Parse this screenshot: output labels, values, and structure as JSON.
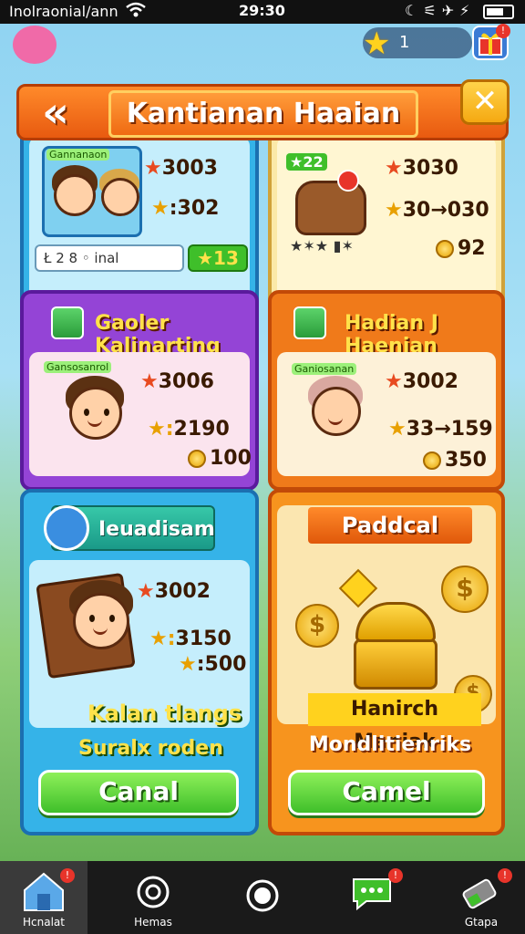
{
  "status_bar": {
    "carrier": "Inolraonial/ann",
    "time": "29:30"
  },
  "top_hud": {
    "star_count": "1"
  },
  "panel": {
    "title": "Kantianan Haaian",
    "back_glyph": "«",
    "close_glyph": "✕"
  },
  "card_top_left": {
    "tag": "Gannanaon",
    "stat_1": "3003",
    "stat_2": ":302",
    "progress_label": "Ł 2 8 ◦ inal",
    "progress": 0.6,
    "reward": "13"
  },
  "card_top_right": {
    "tag": "22",
    "stat_1": "3030",
    "stat_2": "30→030",
    "stars_text": "★✶★ ▮✶",
    "reward": "92"
  },
  "card_mid_left": {
    "header": "Gaoler Kalinarting",
    "tag": "Gansosanrol",
    "stat_1": "3006",
    "stat_2": "2190",
    "coins": "100"
  },
  "card_mid_right": {
    "header": "Hadian J Haenian",
    "tag": "Ganiosanan",
    "stat_1": "3002",
    "stat_2": "33→159",
    "coins": "350"
  },
  "card_bottom_left": {
    "header": "Ieuadisam",
    "stat_1": "3002",
    "stat_2": "3150",
    "stat_3": ":500",
    "line_1": "Kalan tlangs",
    "line_2": "Suralx roden",
    "button": "Canal"
  },
  "card_bottom_right": {
    "header": "Paddcal",
    "line_1": "Hanirch Maniak",
    "line_2": "Mondlitienriks",
    "button": "Camel"
  },
  "bottom_nav": {
    "items": [
      {
        "label": "Hcnalat",
        "badge": "!"
      },
      {
        "label": "Hemas",
        "badge": ""
      },
      {
        "label": "",
        "badge": ""
      },
      {
        "label": "",
        "badge": "!"
      },
      {
        "label": "Gtapa",
        "badge": "!"
      }
    ]
  },
  "colors": {
    "orange": "#f07a1a",
    "purple": "#8a3cc8",
    "blue": "#2a9ee0",
    "green_button": "#3fbf2a",
    "gold": "#ffc21a"
  }
}
